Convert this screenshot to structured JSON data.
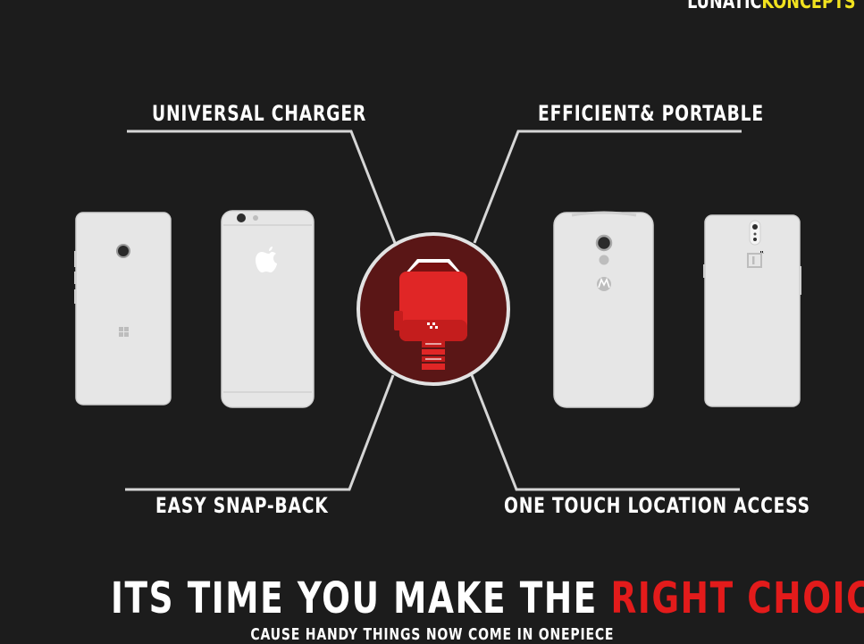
{
  "brand": {
    "part1": "LUNATIC",
    "part2": "KONCEPTS"
  },
  "features": {
    "universal_charger": "UNIVERSAL CHARGER",
    "efficient_portable": "EFFICIENT& PORTABLE",
    "easy_snap_back": "EASY SNAP-BACK",
    "one_touch_location": "ONE TOUCH LOCATION ACCESS"
  },
  "headline": {
    "part1": "ITS TIME YOU MAKE THE",
    "part2": "RIGHT CHOICE"
  },
  "subline": "CAUSE HANDY THINGS NOW COME IN ONEPIECE",
  "colors": {
    "background": "#1c1c1c",
    "phone": "#e6e6e6",
    "accent_red": "#e31b1b",
    "brand_yellow": "#f1e21f",
    "circle_fill": "#5a1616"
  },
  "icons": [
    "windows-logo-icon",
    "apple-logo-icon",
    "motorola-logo-icon",
    "oneplus-logo-icon",
    "charger-device-icon"
  ]
}
